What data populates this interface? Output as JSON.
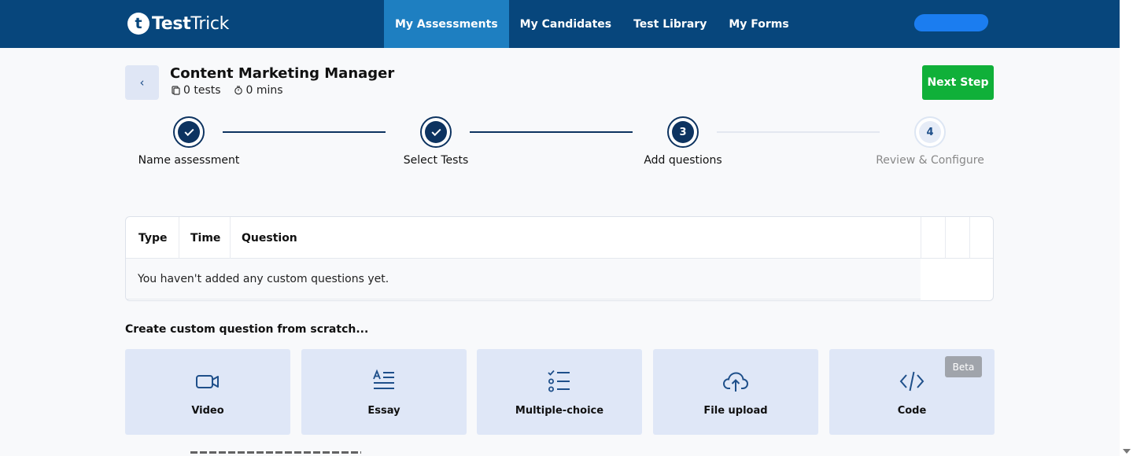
{
  "app": {
    "logo_mark": "t",
    "logo_bold": "Test",
    "logo_light": "Trick"
  },
  "nav": {
    "items": [
      {
        "label": "My Assessments",
        "active": true
      },
      {
        "label": "My Candidates",
        "active": false
      },
      {
        "label": "Test Library",
        "active": false
      },
      {
        "label": "My Forms",
        "active": false
      }
    ]
  },
  "header": {
    "back_icon": "chevron-left-icon",
    "back_glyph": "‹",
    "title": "Content Marketing Manager",
    "tests_count": "0 tests",
    "duration": "0 mins",
    "next_label": "Next Step"
  },
  "stepper": {
    "steps": [
      {
        "label": "Name assessment",
        "state": "done"
      },
      {
        "label": "Select Tests",
        "state": "done"
      },
      {
        "label": "Add questions",
        "state": "current",
        "number": "3"
      },
      {
        "label": "Review & Configure",
        "state": "todo",
        "number": "4"
      }
    ]
  },
  "questions_table": {
    "columns": [
      "Type",
      "Time",
      "Question"
    ],
    "empty_message": "You haven't added any custom questions yet."
  },
  "custom": {
    "section_title": "Create custom question from scratch...",
    "cards": [
      {
        "label": "Video",
        "icon": "video-camera-icon"
      },
      {
        "label": "Essay",
        "icon": "essay-text-icon"
      },
      {
        "label": "Multiple-choice",
        "icon": "checklist-icon"
      },
      {
        "label": "File upload",
        "icon": "cloud-upload-icon"
      },
      {
        "label": "Code",
        "icon": "code-brackets-icon",
        "badge": "Beta"
      }
    ]
  },
  "colors": {
    "nav_bg": "#07467c",
    "nav_active": "#1e7fc1",
    "primary_dark": "#0d3360",
    "next_button": "#10b039",
    "card_bg": "#dfe7f7",
    "icon_blue": "#1e4f8a"
  }
}
